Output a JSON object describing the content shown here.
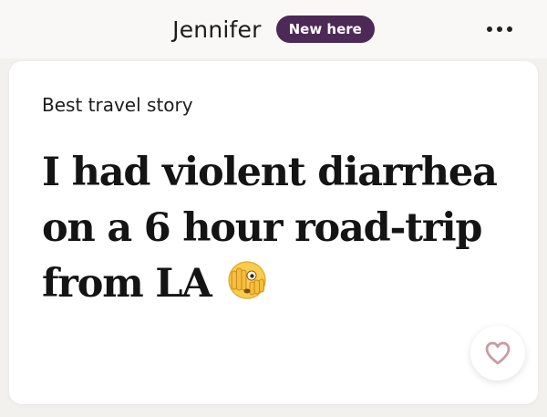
{
  "header": {
    "user_name": "Jennifer",
    "badge_label": "New here",
    "more_icon": "ellipsis-icon"
  },
  "card": {
    "prompt_label": "Best travel story",
    "answer_lines": [
      "I had violent diarrhea",
      "on a 6 hour road-trip",
      "from LA"
    ],
    "emoji_icon": "face-with-hand-over-eyes-emoji",
    "like_icon": "heart-outline-icon"
  },
  "colors": {
    "badge_background": "#4c2956",
    "page_background": "#f3f1ee",
    "card_background": "#ffffff",
    "heart_stroke": "#c99ca4"
  }
}
